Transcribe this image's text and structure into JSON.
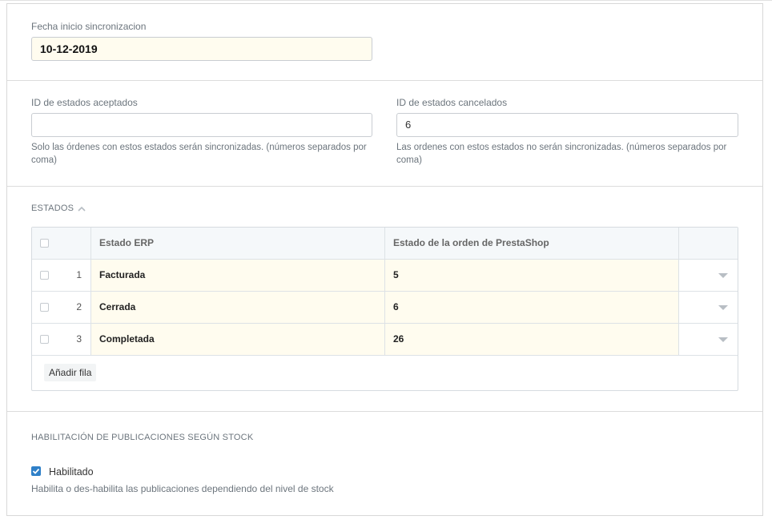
{
  "sync": {
    "start_date_label": "Fecha inicio sincronizacion",
    "start_date_value": "10-12-2019"
  },
  "states_ids": {
    "accepted_label": "ID de estados aceptados",
    "accepted_value": "",
    "accepted_help": "Solo las órdenes con estos estados serán sincronizadas. (números separados por coma)",
    "cancelled_label": "ID de estados cancelados",
    "cancelled_value": "6",
    "cancelled_help": "Las ordenes con estos estados no serán sincronizadas. (números separados por coma)"
  },
  "estados": {
    "title": "ESTADOS",
    "columns": [
      "Estado ERP",
      "Estado de la orden de PrestaShop"
    ],
    "rows": [
      {
        "num": "1",
        "erp": "Facturada",
        "presta": "5"
      },
      {
        "num": "2",
        "erp": "Cerrada",
        "presta": "6"
      },
      {
        "num": "3",
        "erp": "Completada",
        "presta": "26"
      }
    ],
    "add_row_label": "Añadir fila"
  },
  "stock": {
    "title": "HABILITACIÓN DE PUBLICACIONES SEGÚN STOCK",
    "enabled_label": "Habilitado",
    "enabled_checked": true,
    "help": "Habilita o des-habilita las publicaciones dependiendo del nivel de stock"
  },
  "colors": {
    "accent": "#2f80c8",
    "field_highlight": "#fffcef"
  }
}
